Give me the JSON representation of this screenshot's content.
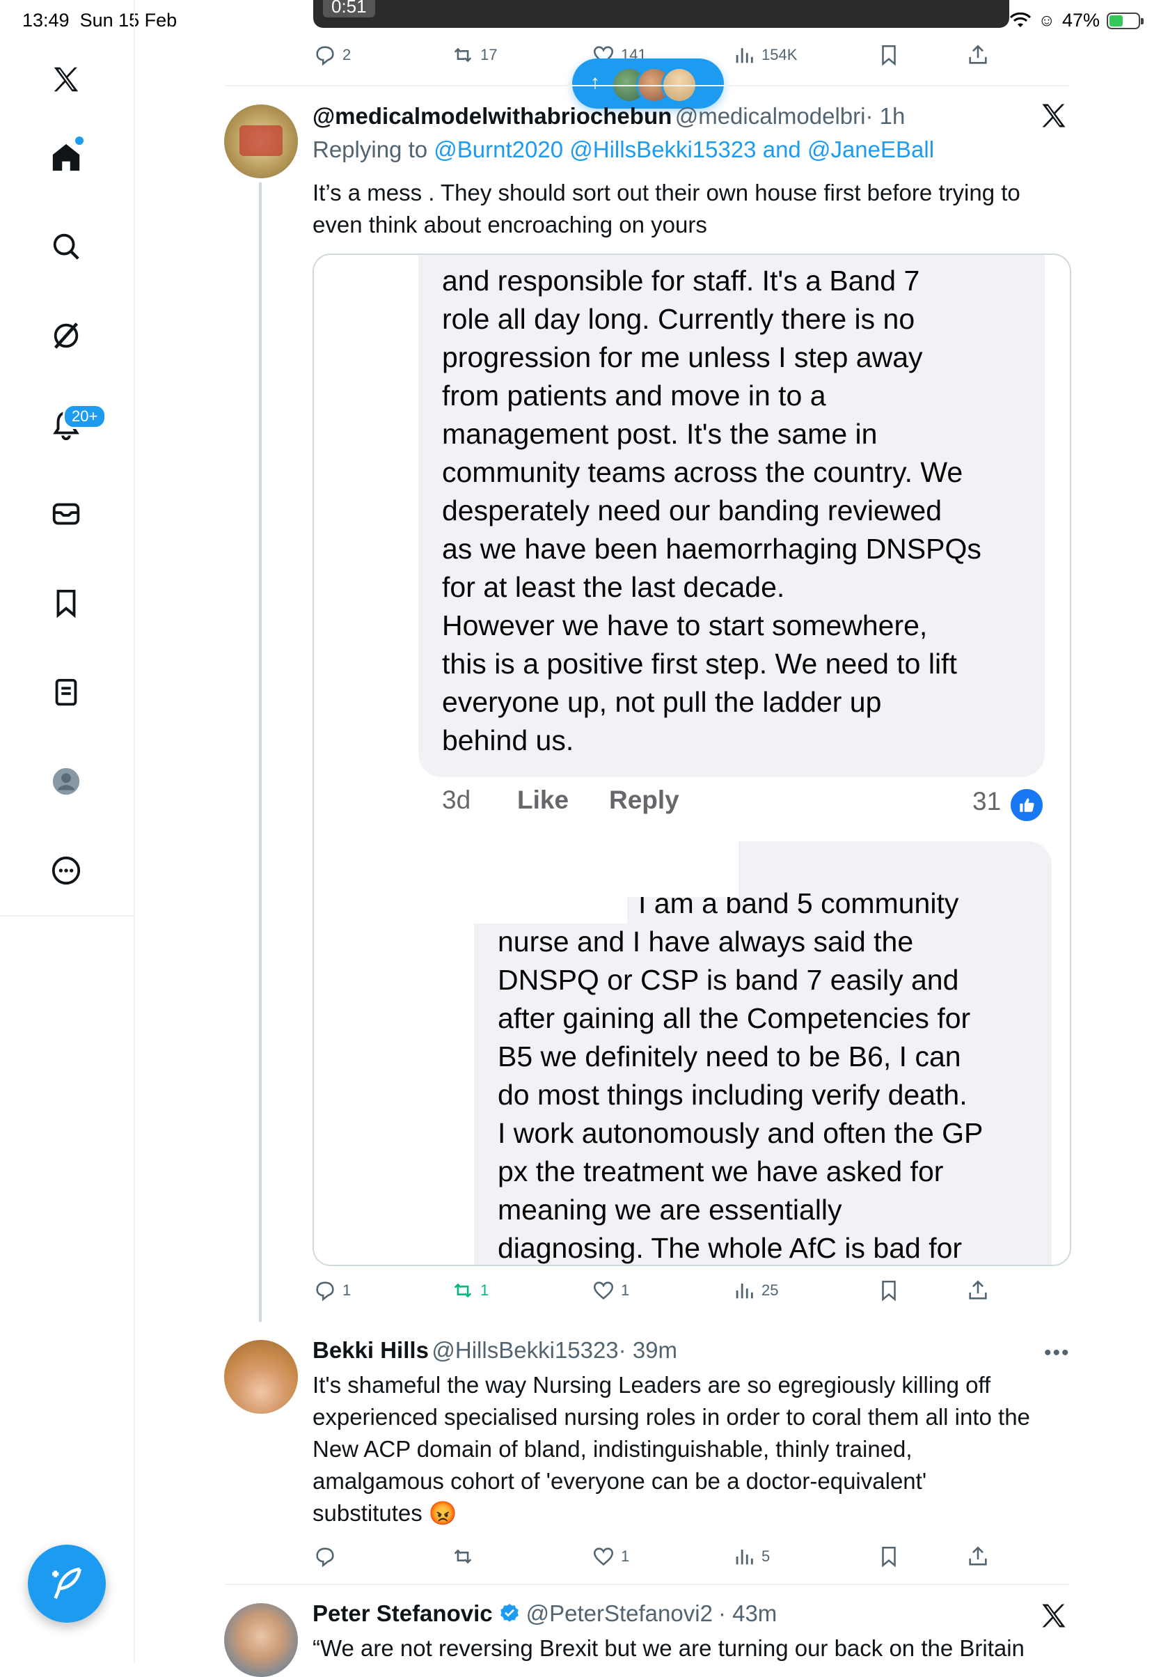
{
  "status_bar": {
    "time": "13:49",
    "date": "Sun 15 Feb",
    "battery": "47%",
    "battery_level": 0.47
  },
  "sidebar": {
    "items": [
      "x-logo",
      "home",
      "search",
      "grok",
      "notifications",
      "messages",
      "bookmarks",
      "lists",
      "profile",
      "more"
    ],
    "notifications_badge": "20+"
  },
  "video": {
    "time": "0:51"
  },
  "top_actions": {
    "replies": "2",
    "reposts": "17",
    "likes": "141",
    "views": "154K"
  },
  "new_posts_pill": {
    "arrow": "↑"
  },
  "tweet1": {
    "username": "@medicalmodelwithabriochebun",
    "handle": "@medicalmodelbri",
    "time": "· 1h",
    "replying_prefix": "Replying to",
    "reply_to_1": "@Burnt2020",
    "reply_to_2": "@HillsBekki15323",
    "reply_and": "and",
    "reply_to_3": "@JaneEBall",
    "text": "It’s a mess . They should sort out their own house first before trying to even think about encroaching on yours",
    "image": {
      "comment1_lines": [
        "and responsible for staff. It's a Band 7",
        "role all day long. Currently there is no",
        "progression for me unless I step away",
        "from patients and move in to a",
        "management post. It's the same in",
        "community teams across the country. We",
        "desperately need our banding reviewed",
        "as we have been haemorrhaging DNSPQs",
        "for at least the last decade.",
        "However we have to start somewhere,",
        "this is a positive first step. We need to lift",
        "everyone up, not pull the ladder up",
        "behind us."
      ],
      "comment1_time": "3d",
      "comment1_like": "Like",
      "comment1_reply": "Reply",
      "comment1_count": "31",
      "comment2_lines": [
        "I am a band 5 community",
        "nurse and I have always said the",
        "DNSPQ or CSP is band 7 easily and",
        "after gaining all the Competencies for",
        "B5 we definitely need to be B6, I can",
        "do most things including verify death.",
        "I work autonomously and often the GP",
        "px the treatment we have asked for",
        "meaning we are essentially",
        "diagnosing. The whole AfC is bad for"
      ]
    },
    "actions": {
      "replies": "1",
      "reposts": "1",
      "likes": "1",
      "views": "25"
    }
  },
  "tweet2": {
    "name": "Bekki Hills",
    "handle": "@HillsBekki15323",
    "time": "· 39m",
    "lines": [
      "It's shameful the way Nursing Leaders are so egregiously killing off",
      "experienced specialised nursing roles in order to coral them all into the",
      "New ACP domain of bland, indistinguishable, thinly trained,",
      "amalgamous cohort of 'everyone  can be a doctor-equivalent'",
      "substitutes"
    ],
    "emoji": "😡",
    "actions": {
      "replies": "",
      "reposts": "",
      "likes": "1",
      "views": "5"
    }
  },
  "tweet3": {
    "name": "Peter Stefanovic",
    "handle": "@PeterStefanovi2",
    "time": "· 43m",
    "text": "“We are not reversing Brexit but we are turning our back on the Britain"
  },
  "colors": {
    "accent": "#1d9bf0",
    "text": "#0f1419",
    "secondary": "#536471",
    "repost_active": "#00ba7c",
    "fb_like": "#1877f2"
  }
}
